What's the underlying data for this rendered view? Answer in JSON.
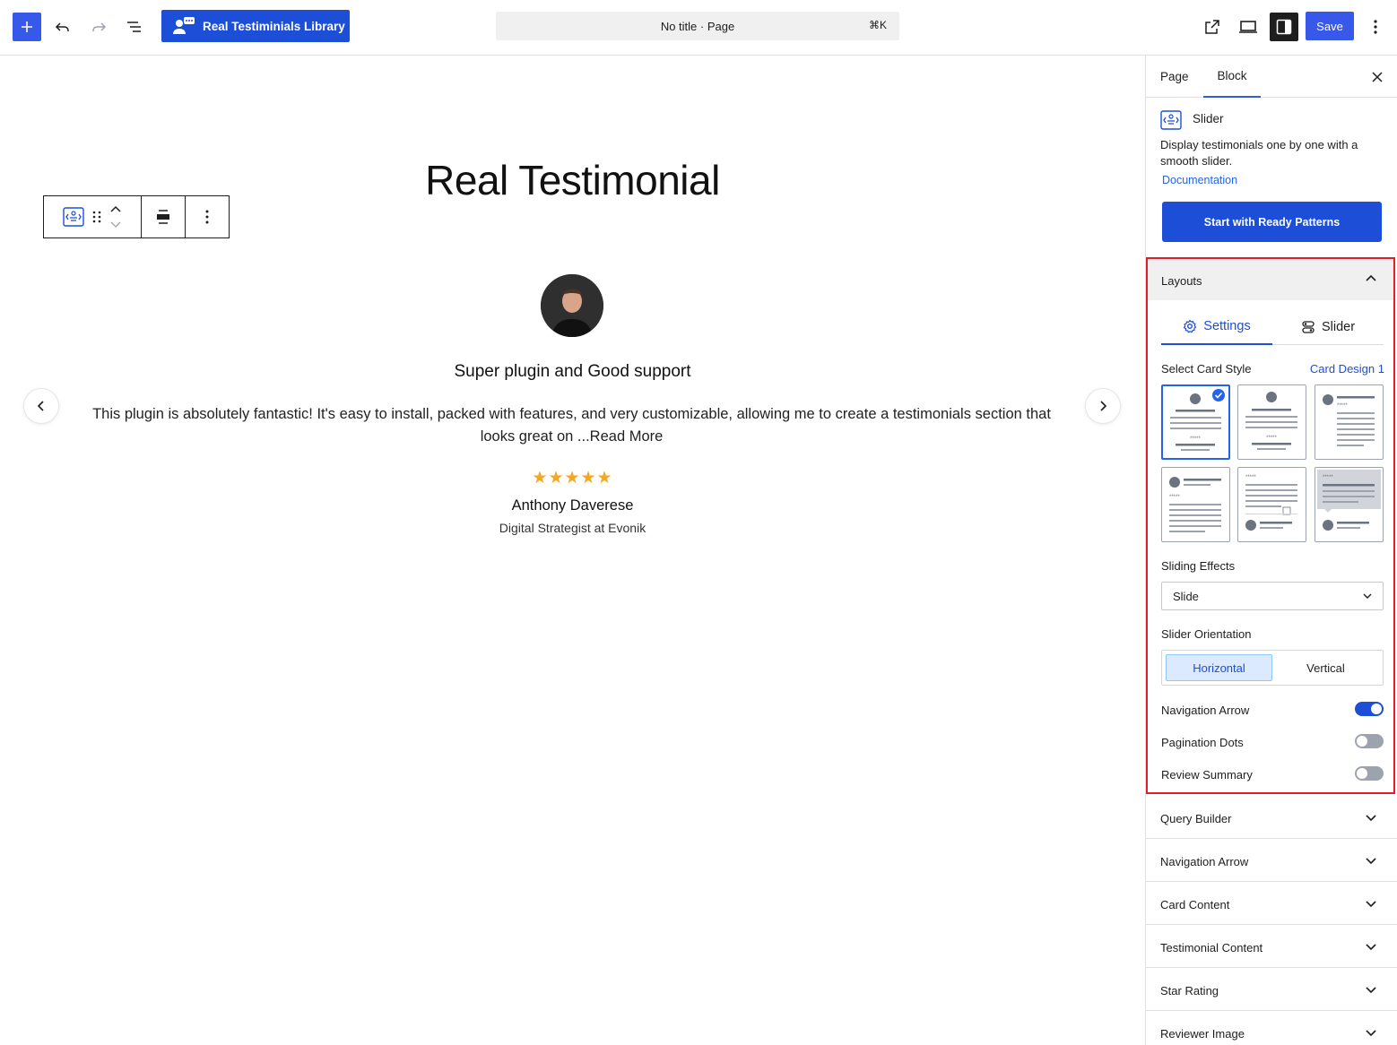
{
  "topbar": {
    "library_label": "Real Testiminials Library",
    "command_bar": "No title · Page",
    "command_shortcut": "⌘K",
    "save_label": "Save"
  },
  "canvas": {
    "title": "Real Testimonial",
    "testimonial": {
      "heading": "Super plugin and Good support",
      "body": "This plugin is absolutely fantastic! It's easy to install, packed with features, and very customizable, allowing me to create a testimonials section that looks great on ...Read More",
      "stars": "★★★★★",
      "rating": 5,
      "name": "Anthony Daverese",
      "role": "Digital Strategist at Evonik"
    }
  },
  "sidebar": {
    "tabs": {
      "page": "Page",
      "block": "Block"
    },
    "block": {
      "name": "Slider",
      "description": "Display testimonials one by one with a smooth slider.",
      "doc_link": "Documentation",
      "ready_patterns": "Start with Ready Patterns"
    },
    "layouts": {
      "title": "Layouts",
      "tabs": {
        "settings": "Settings",
        "slider": "Slider"
      },
      "card_style_label": "Select Card Style",
      "card_style_value": "Card Design 1",
      "sliding_effects_label": "Sliding Effects",
      "sliding_effects_value": "Slide",
      "orientation_label": "Slider Orientation",
      "orientation_options": {
        "horizontal": "Horizontal",
        "vertical": "Vertical"
      },
      "orientation_selected": "Horizontal",
      "toggles": [
        {
          "label": "Navigation Arrow",
          "on": true
        },
        {
          "label": "Pagination Dots",
          "on": false
        },
        {
          "label": "Review Summary",
          "on": false
        }
      ]
    },
    "panels": [
      "Query Builder",
      "Navigation Arrow",
      "Card Content",
      "Testimonial Content",
      "Star Rating",
      "Reviewer Image"
    ]
  },
  "colors": {
    "accent": "#3858e9",
    "primary_button": "#1d4ed8",
    "highlight_border": "#e11d2e",
    "star": "#f5a623"
  }
}
